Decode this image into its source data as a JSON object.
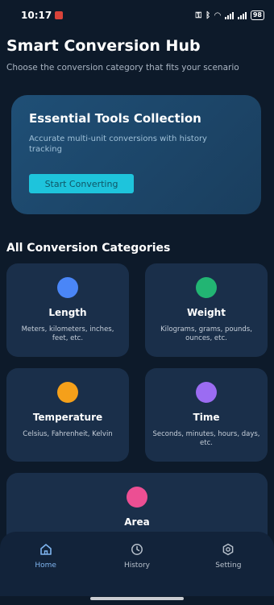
{
  "status_bar": {
    "time": "10:17",
    "battery": "98"
  },
  "header": {
    "title": "Smart Conversion Hub",
    "subtitle": "Choose the conversion category that fits your scenario"
  },
  "hero": {
    "title": "Essential Tools Collection",
    "description": "Accurate multi-unit conversions with history tracking",
    "button_label": "Start Converting"
  },
  "section_title": "All Conversion Categories",
  "categories": [
    {
      "name": "Length",
      "desc": "Meters, kilometers, inches, feet, etc.",
      "color": "#4a86f7"
    },
    {
      "name": "Weight",
      "desc": "Kilograms, grams, pounds, ounces, etc.",
      "color": "#22b573"
    },
    {
      "name": "Temperature",
      "desc": "Celsius, Fahrenheit, Kelvin",
      "color": "#f5a01a"
    },
    {
      "name": "Time",
      "desc": "Seconds, minutes, hours, days, etc.",
      "color": "#9b6cf2"
    },
    {
      "name": "Area",
      "desc": "",
      "color": "#ec4f93"
    }
  ],
  "nav": {
    "items": [
      {
        "label": "Home",
        "icon": "home-icon"
      },
      {
        "label": "History",
        "icon": "history-icon"
      },
      {
        "label": "Setting",
        "icon": "settings-icon"
      }
    ],
    "active": "Home",
    "active_color": "#7fb5f0"
  }
}
